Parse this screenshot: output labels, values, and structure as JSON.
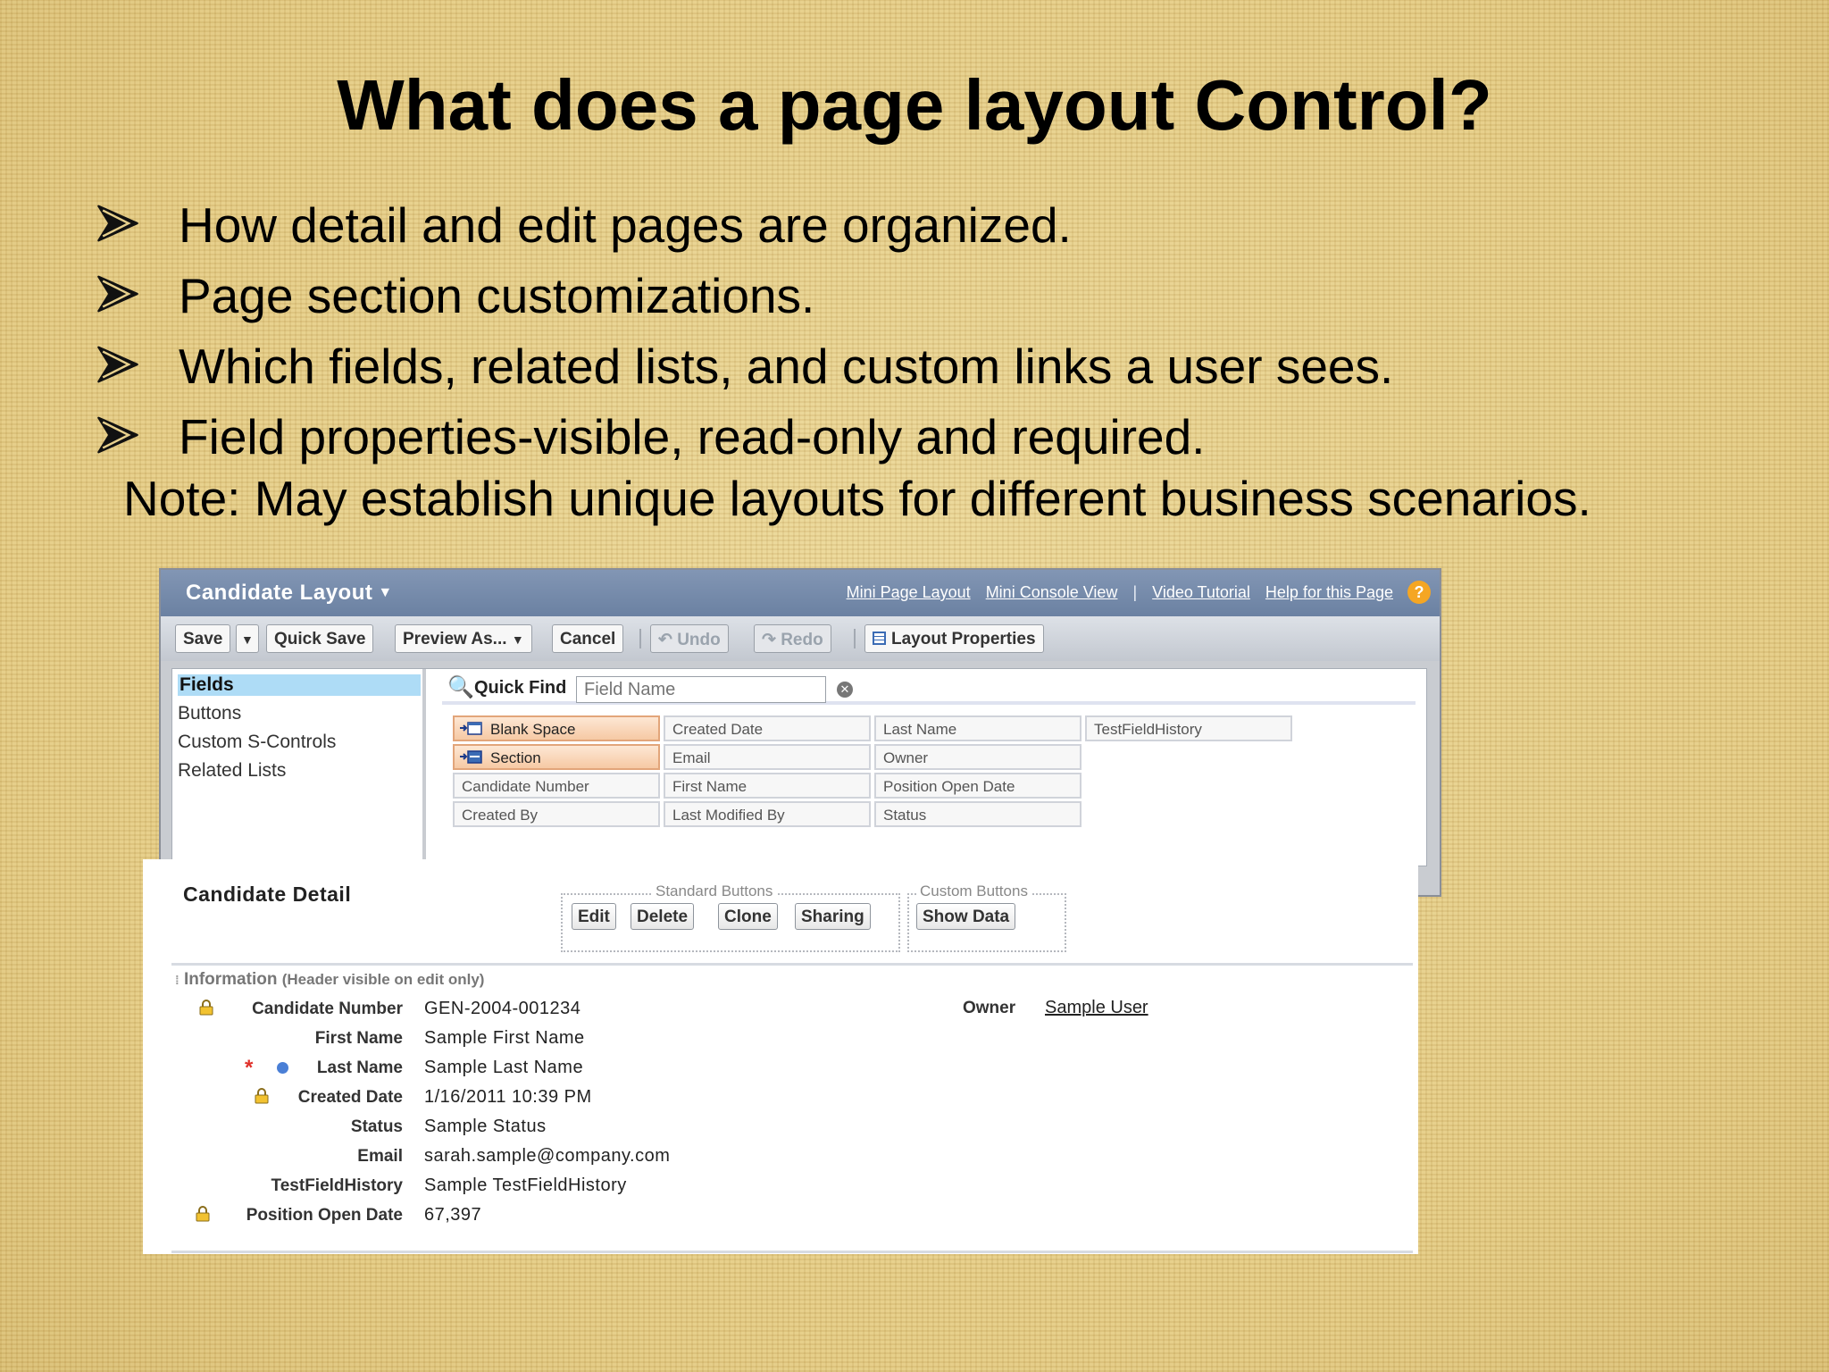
{
  "slide": {
    "title": "What does a page layout Control?",
    "bullets": [
      "How detail and edit pages are organized.",
      "Page section customizations.",
      "Which fields, related lists, and custom links a user sees.",
      "Field properties-visible, read-only and required."
    ],
    "note": "Note: May establish unique layouts for different business scenarios."
  },
  "layout_editor": {
    "header_title": "Candidate Layout",
    "links": [
      "Mini Page Layout",
      "Mini Console View",
      "Video Tutorial",
      "Help for this Page"
    ],
    "link_separator": "|",
    "help_icon": "?",
    "toolbar": {
      "save": "Save",
      "quick_save": "Quick Save",
      "preview_as": "Preview As...",
      "cancel": "Cancel",
      "undo": "Undo",
      "redo": "Redo",
      "layout_properties": "Layout Properties"
    },
    "palette_categories": [
      "Fields",
      "Buttons",
      "Custom S-Controls",
      "Related Lists"
    ],
    "quick_find_label": "Quick Find",
    "quick_find_placeholder": "Field Name",
    "fields": [
      [
        "Blank Space",
        "Created Date",
        "Last Name",
        "TestFieldHistory"
      ],
      [
        "Section",
        "Email",
        "Owner"
      ],
      [
        "Candidate Number",
        "First Name",
        "Position Open Date"
      ],
      [
        "Created By",
        "Last Modified By",
        "Status"
      ]
    ]
  },
  "detail": {
    "title": "Candidate Detail",
    "standard_buttons_label": "Standard Buttons",
    "custom_buttons_label": "Custom Buttons",
    "standard_buttons": [
      "Edit",
      "Delete",
      "Clone",
      "Sharing"
    ],
    "custom_buttons": [
      "Show Data"
    ],
    "section_header": "Information",
    "section_header_note": "(Header visible on edit only)",
    "rows": [
      {
        "label": "Candidate Number",
        "value": "GEN-2004-001234"
      },
      {
        "label": "First Name",
        "value": "Sample First Name"
      },
      {
        "label": "Last Name",
        "value": "Sample Last Name"
      },
      {
        "label": "Created Date",
        "value": "1/16/2011 10:39 PM"
      },
      {
        "label": "Status",
        "value": "Sample Status"
      },
      {
        "label": "Email",
        "value": "sarah.sample@company.com"
      },
      {
        "label": "TestFieldHistory",
        "value": "Sample TestFieldHistory"
      },
      {
        "label": "Position Open Date",
        "value": "67,397"
      }
    ],
    "owner_label": "Owner",
    "owner_value": "Sample User",
    "required_marker": "*"
  }
}
